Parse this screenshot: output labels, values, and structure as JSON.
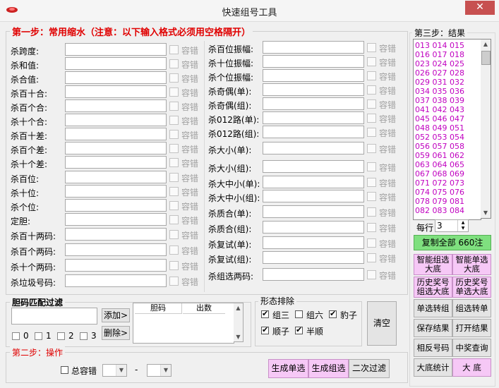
{
  "window": {
    "title": "快速组号工具",
    "close_symbol": "✕"
  },
  "step1": {
    "legend": "第一步：常用缩水（注意：以下输入格式必须用空格隔开）",
    "tolerance_label": "容错",
    "left_rows": [
      {
        "label": "杀跨度:"
      },
      {
        "label": "杀和值:"
      },
      {
        "label": "杀合值:"
      },
      {
        "label": "杀百十合:"
      },
      {
        "label": "杀百个合:"
      },
      {
        "label": "杀十个合:"
      },
      {
        "label": "杀百十差:"
      },
      {
        "label": "杀百个差:"
      },
      {
        "label": "杀十个差:"
      },
      {
        "label": "杀百位:"
      },
      {
        "label": "杀十位:"
      },
      {
        "label": "杀个位:"
      },
      {
        "label": "定胆:"
      },
      {
        "label": "杀百十两码:"
      },
      {
        "label": "杀百个两码:"
      },
      {
        "label": "杀十个两码:"
      },
      {
        "label": "杀垃圾号码:"
      }
    ],
    "right_rows": [
      {
        "label": "杀百位振幅:"
      },
      {
        "label": "杀十位振幅:"
      },
      {
        "label": "杀个位振幅:"
      },
      {
        "label": "杀奇偶(单):"
      },
      {
        "label": "杀奇偶(组):"
      },
      {
        "label": "杀012路(单):"
      },
      {
        "label": "杀012路(组):"
      },
      {
        "label": "杀大小(单):"
      },
      {
        "label": "杀大小(组):"
      },
      {
        "label": "杀大中小(单):"
      },
      {
        "label": "杀大中小(组):"
      },
      {
        "label": "杀质合(单):"
      },
      {
        "label": "杀质合(组):"
      },
      {
        "label": "杀复试(单):"
      },
      {
        "label": "杀复试(组):"
      },
      {
        "label": "杀组选两码:"
      }
    ]
  },
  "dan_filter": {
    "legend": "胆码匹配过滤",
    "add_button": "添加>",
    "delete_button": "删除>",
    "table_headers": [
      "胆码",
      "出数"
    ],
    "count_options": [
      "0",
      "1",
      "2",
      "3"
    ]
  },
  "shape_exclude": {
    "legend": "形态排除",
    "options": [
      {
        "label": "组三",
        "checked": true
      },
      {
        "label": "组六",
        "checked": false
      },
      {
        "label": "豹子",
        "checked": true
      },
      {
        "label": "顺子",
        "checked": true
      },
      {
        "label": "半顺",
        "checked": true
      }
    ],
    "clear_button": "清空"
  },
  "step2": {
    "legend": "第二步：操作",
    "total_tolerance_label": "总容错",
    "separator": "-",
    "gen_single_button": "生成单选",
    "gen_group_button": "生成组选",
    "second_filter_button": "二次过滤"
  },
  "step3": {
    "legend": "第三步：结果",
    "results": [
      "013 014 015",
      "016 017 018",
      "023 024 025",
      "026 027 028",
      "029 031 032",
      "034 035 036",
      "037 038 039",
      "041 042 043",
      "045 046 047",
      "048 049 051",
      "052 053 054",
      "056 057 058",
      "059 061 062",
      "063 064 065",
      "067 068 069",
      "071 072 073",
      "074 075 076",
      "078 079 081",
      "082 083 084"
    ],
    "per_row_label": "每行",
    "per_row_value": "3",
    "copy_all_button": "复制全部 660注",
    "side_buttons": [
      {
        "label": "智能组选\n大底",
        "style": "pink"
      },
      {
        "label": "智能单选\n大底",
        "style": "pink"
      },
      {
        "label": "历史奖号\n组选大底",
        "style": "pink"
      },
      {
        "label": "历史奖号\n单选大底",
        "style": "pink"
      },
      {
        "label": "单选转组",
        "style": "plain"
      },
      {
        "label": "组选转单",
        "style": "plain"
      },
      {
        "label": "保存结果",
        "style": "plain"
      },
      {
        "label": "打开结果",
        "style": "plain"
      },
      {
        "label": "相反号码",
        "style": "plain"
      },
      {
        "label": "中奖查询",
        "style": "plain"
      },
      {
        "label": "大底统计",
        "style": "plain"
      },
      {
        "label": "大 底",
        "style": "pink"
      }
    ]
  },
  "colors": {
    "accent_red": "#e00000",
    "result_text": "#c000c0",
    "pink_button": "#f6c8f6",
    "green_button": "#7fe07f",
    "close_red": "#c75050"
  }
}
